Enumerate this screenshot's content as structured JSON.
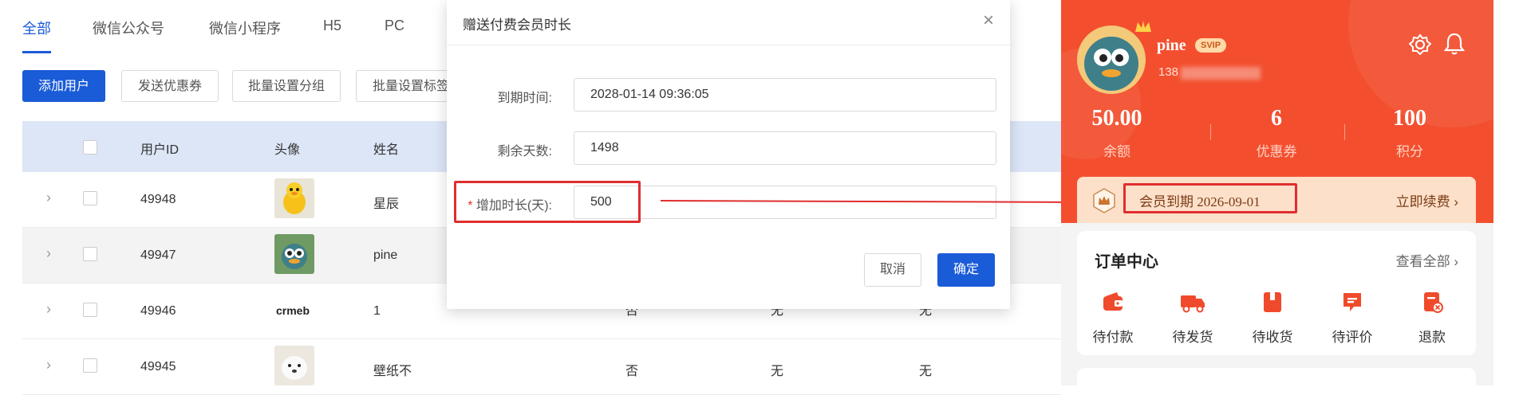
{
  "tabs": [
    "全部",
    "微信公众号",
    "微信小程序",
    "H5",
    "PC"
  ],
  "toolbar": {
    "add_user": "添加用户",
    "send_coupon": "发送优惠券",
    "batch_group": "批量设置分组",
    "batch_tag": "批量设置标签"
  },
  "table": {
    "headers": {
      "id": "用户ID",
      "avatar": "头像",
      "name": "姓名"
    },
    "rows": [
      {
        "id": "49948",
        "name": "星辰",
        "col4": "",
        "col5": "",
        "col6": ""
      },
      {
        "id": "49947",
        "name": "pine",
        "col4": "",
        "col5": "",
        "col6": ""
      },
      {
        "id": "49946",
        "name": "1",
        "col4": "否",
        "col5": "无",
        "col6": "无",
        "avatar_text": "crmeb"
      },
      {
        "id": "49945",
        "name": "壁纸不",
        "col4": "否",
        "col5": "无",
        "col6": "无"
      }
    ]
  },
  "dialog": {
    "title": "赠送付费会员时长",
    "close": "×",
    "expire_label": "到期时间:",
    "expire_value": "2028-01-14 09:36:05",
    "remain_label": "剩余天数:",
    "remain_value": "1498",
    "add_label_star": "*",
    "add_label": "增加时长(天):",
    "add_value": "500",
    "cancel": "取消",
    "confirm": "确定"
  },
  "phone": {
    "username": "pine",
    "svip": "SVIP",
    "phone": "138",
    "stats": [
      {
        "value": "50.00",
        "label": "余额"
      },
      {
        "value": "6",
        "label": "优惠券"
      },
      {
        "value": "100",
        "label": "积分"
      }
    ],
    "member_expire": "会员到期 2026-09-01",
    "renew": "立即续费",
    "order_center": "订单中心",
    "view_all": "查看全部",
    "orders": [
      {
        "label": "待付款",
        "icon": "wallet-icon"
      },
      {
        "label": "待发货",
        "icon": "truck-icon"
      },
      {
        "label": "待收货",
        "icon": "box-icon"
      },
      {
        "label": "待评价",
        "icon": "comment-icon"
      },
      {
        "label": "退款",
        "icon": "refund-icon"
      }
    ]
  },
  "colors": {
    "primary": "#1a5bd8",
    "hero": "#f34f2f",
    "highlight": "#e02e2e",
    "order_icon": "#f04a2c"
  }
}
